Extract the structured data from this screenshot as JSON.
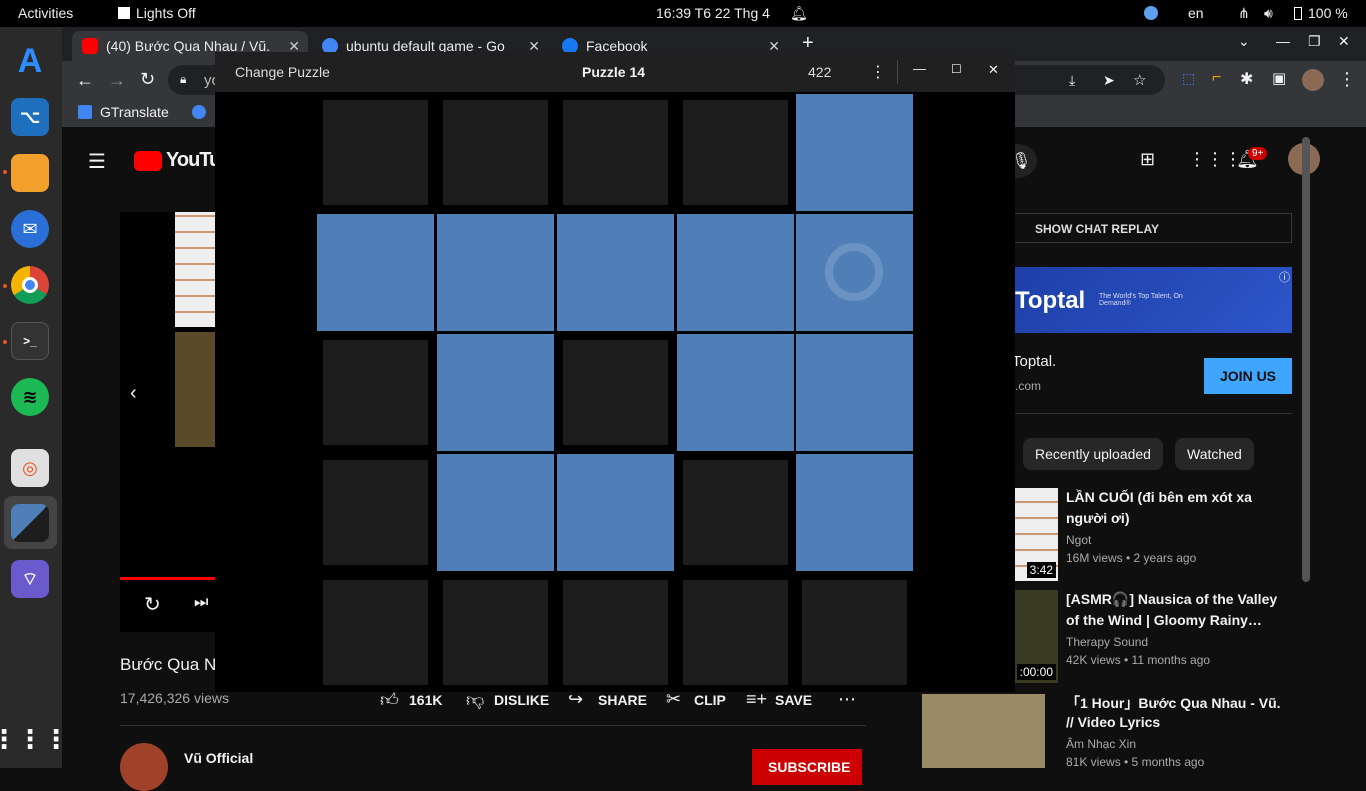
{
  "topbar": {
    "activities": "Activities",
    "lights_off": "Lights Off",
    "clock": "16:39  T6 22 Thg 4",
    "lang": "en",
    "battery": "100 %"
  },
  "browser": {
    "tabs": [
      {
        "title": "(40) Bước Qua Nhau / Vũ.",
        "icon": "youtube-icon",
        "color": "#ff0000"
      },
      {
        "title": "ubuntu default game - Go",
        "icon": "google-icon",
        "color": "#4285f4"
      },
      {
        "title": "Facebook",
        "icon": "facebook-icon",
        "color": "#1877f2"
      }
    ],
    "address_partial": "yo",
    "bookmark": "GTranslate"
  },
  "youtube": {
    "logo": "YouTub",
    "video_title": "Bước Qua N",
    "views": "17,426,326 views",
    "likes": "161K",
    "dislike": "DISLIKE",
    "share": "SHARE",
    "clip": "CLIP",
    "save": "SAVE",
    "channel": "Vũ Official",
    "subscribe": "SUBSCRIBE",
    "notif_badge": "9+",
    "chat_replay": "SHOW CHAT REPLAY",
    "ad_brand": "Toptal",
    "ad_tagline": "The World's Top Talent, On Demand®",
    "ad_name": "Toptal.",
    "ad_url": ".com",
    "join_us": "JOIN US",
    "chips": [
      "Recently uploaded",
      "Watched"
    ],
    "recs": [
      {
        "title1": "LẦN CUỐI (đi bên em xót xa",
        "title2": "người ơi)",
        "channel": "Ngot",
        "meta": "16M views • 2 years ago",
        "duration": "3:42"
      },
      {
        "title1": "[ASMR🎧] Nausica of the Valley",
        "title2": "of the Wind | Gloomy Rainy…",
        "channel": "Therapy Sound",
        "meta": "42K views • 11 months ago",
        "duration": ":00:00"
      },
      {
        "title1": "「1 Hour」Bước Qua Nhau - Vũ.",
        "title2": "// Video Lyrics",
        "channel": "Âm Nhạc Xin",
        "meta": "81K views • 5 months ago",
        "duration": ""
      }
    ]
  },
  "puzzle": {
    "change_puzzle": "Change Puzzle",
    "title": "Puzzle 14",
    "moves": "422",
    "grid": [
      [
        "dark",
        "dark",
        "dark",
        "dark",
        "blue"
      ],
      [
        "blue",
        "blue",
        "blue",
        "blue",
        "blue-ring"
      ],
      [
        "dark",
        "blue",
        "dark",
        "blue",
        "blue"
      ],
      [
        "dark",
        "blue",
        "blue",
        "dark",
        "blue"
      ],
      [
        "dark",
        "dark",
        "dark",
        "dark",
        "dark"
      ]
    ],
    "colors": {
      "lit": "#4f7fb6",
      "unlit": "#1d1d1d",
      "ring": "#6a93c4"
    }
  }
}
